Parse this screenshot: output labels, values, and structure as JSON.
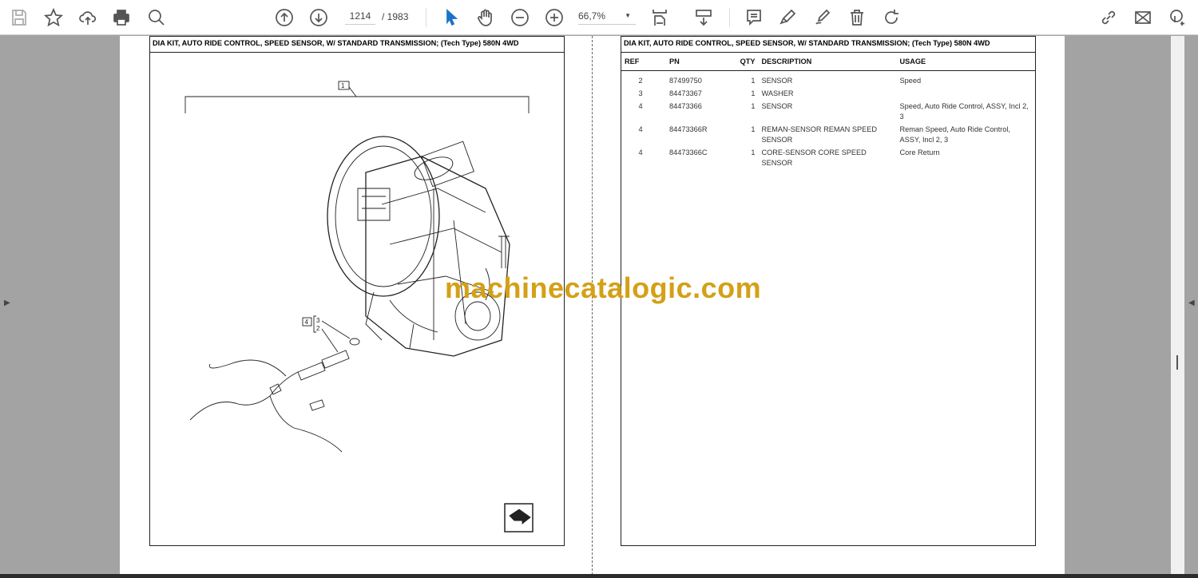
{
  "toolbar": {
    "left_icons": [
      "save-icon",
      "star-icon",
      "upload-cloud-icon",
      "print-icon",
      "search-zoom-icon"
    ],
    "nav_icons": [
      "page-up-icon",
      "page-down-icon"
    ],
    "current_page": "1214",
    "total_pages": "/ 1983",
    "tools": [
      "select-arrow-icon",
      "hand-icon",
      "zoom-out-icon",
      "zoom-in-icon"
    ],
    "zoom_level": "66,7%",
    "right_icons": [
      "fit-page-icon",
      "scroll-mode-icon",
      "comment-icon",
      "highlight-icon",
      "sign-icon",
      "delete-icon",
      "rotate-icon"
    ],
    "far_right_icons": [
      "share-link-icon",
      "email-icon",
      "add-user-icon"
    ],
    "accent": "#1a73c8"
  },
  "left_page": {
    "title": "DIA KIT, AUTO RIDE CONTROL, SPEED SENSOR, W/ STANDARD TRANSMISSION; (Tech Type) 580N 4WD",
    "callouts": {
      "top": "1",
      "group": "4",
      "items": [
        "3",
        "2"
      ]
    }
  },
  "right_page": {
    "title": "DIA KIT, AUTO RIDE CONTROL, SPEED SENSOR, W/ STANDARD TRANSMISSION; (Tech Type) 580N 4WD",
    "columns": [
      "REF",
      "PN",
      "QTY",
      "DESCRIPTION",
      "USAGE"
    ],
    "rows": [
      {
        "ref": "2",
        "pn": "87499750",
        "qty": "1",
        "description": "SENSOR",
        "usage": "Speed"
      },
      {
        "ref": "3",
        "pn": "84473367",
        "qty": "1",
        "description": "WASHER",
        "usage": ""
      },
      {
        "ref": "4",
        "pn": "84473366",
        "qty": "1",
        "description": "SENSOR",
        "usage": "Speed, Auto Ride Control, ASSY, Incl 2, 3"
      },
      {
        "ref": "4",
        "pn": "84473366R",
        "qty": "1",
        "description": "REMAN-SENSOR REMAN SPEED SENSOR",
        "usage": "Reman Speed, Auto Ride Control, ASSY, Incl 2, 3"
      },
      {
        "ref": "4",
        "pn": "84473366C",
        "qty": "1",
        "description": "CORE-SENSOR CORE SPEED SENSOR",
        "usage": "Core Return"
      }
    ]
  },
  "watermark": "machinecatalogic.com",
  "watermark_color": "#d4a017"
}
